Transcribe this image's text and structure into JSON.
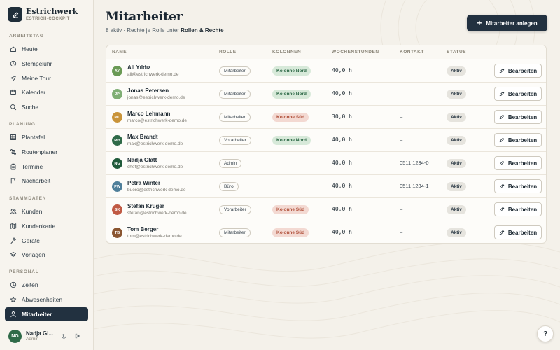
{
  "brand": {
    "name": "Estrichwerk",
    "subtitle": "ESTRICH-COCKPIT"
  },
  "sidebar": {
    "sections": [
      {
        "label": "ARBEITSTAG",
        "items": [
          {
            "label": "Heute",
            "icon": "home-icon"
          },
          {
            "label": "Stempeluhr",
            "icon": "clock-icon"
          },
          {
            "label": "Meine Tour",
            "icon": "send-icon"
          },
          {
            "label": "Kalender",
            "icon": "calendar-icon"
          },
          {
            "label": "Suche",
            "icon": "search-icon"
          }
        ]
      },
      {
        "label": "PLANUNG",
        "items": [
          {
            "label": "Plantafel",
            "icon": "grid-icon"
          },
          {
            "label": "Routenplaner",
            "icon": "route-icon"
          },
          {
            "label": "Termine",
            "icon": "clipboard-icon"
          },
          {
            "label": "Nacharbeit",
            "icon": "flag-icon"
          }
        ]
      },
      {
        "label": "STAMMDATEN",
        "items": [
          {
            "label": "Kunden",
            "icon": "users-icon"
          },
          {
            "label": "Kundenkarte",
            "icon": "map-icon"
          },
          {
            "label": "Geräte",
            "icon": "hammer-icon"
          },
          {
            "label": "Vorlagen",
            "icon": "layers-icon"
          }
        ]
      },
      {
        "label": "PERSONAL",
        "items": [
          {
            "label": "Zeiten",
            "icon": "clock-icon"
          },
          {
            "label": "Abwesenheiten",
            "icon": "star-icon"
          },
          {
            "label": "Mitarbeiter",
            "icon": "user-icon",
            "active": true
          }
        ]
      }
    ]
  },
  "user": {
    "initials": "NG",
    "name": "Nadja Gl...",
    "role": "Admin"
  },
  "page": {
    "title": "Mitarbeiter",
    "subtitle_prefix": "8 aktiv · Rechte je Rolle unter ",
    "subtitle_link": "Rollen & Rechte",
    "add_button": "Mitarbeiter anlegen"
  },
  "table": {
    "headers": {
      "name": "NAME",
      "role": "ROLLE",
      "columns": "KOLONNEN",
      "hours": "WOCHENSTUNDEN",
      "contact": "KONTAKT",
      "status": "STATUS"
    },
    "edit_label": "Bearbeiten",
    "rows": [
      {
        "initials": "AY",
        "avatar_color": "#6a9a55",
        "name": "Ali Yıldız",
        "email": "ali@estrichwerk-demo.de",
        "role": "Mitarbeiter",
        "column": "Kolonne Nord",
        "column_type": "nord",
        "hours": "40,0 h",
        "contact": "–",
        "status": "Aktiv"
      },
      {
        "initials": "JP",
        "avatar_color": "#7fae74",
        "name": "Jonas Petersen",
        "email": "jonas@estrichwerk-demo.de",
        "role": "Mitarbeiter",
        "column": "Kolonne Nord",
        "column_type": "nord",
        "hours": "40,0 h",
        "contact": "–",
        "status": "Aktiv"
      },
      {
        "initials": "ML",
        "avatar_color": "#c9943a",
        "name": "Marco Lehmann",
        "email": "marco@estrichwerk-demo.de",
        "role": "Mitarbeiter",
        "column": "Kolonne Süd",
        "column_type": "sued",
        "hours": "30,0 h",
        "contact": "–",
        "status": "Aktiv"
      },
      {
        "initials": "MB",
        "avatar_color": "#2f6a48",
        "name": "Max Brandt",
        "email": "max@estrichwerk-demo.de",
        "role": "Vorarbeiter",
        "column": "Kolonne Nord",
        "column_type": "nord",
        "hours": "40,0 h",
        "contact": "–",
        "status": "Aktiv"
      },
      {
        "initials": "NG",
        "avatar_color": "#1f5a3a",
        "name": "Nadja Glatt",
        "email": "chef@estrichwerk-demo.de",
        "role": "Admin",
        "column": "",
        "column_type": "",
        "hours": "40,0 h",
        "contact": "0511 1234-0",
        "status": "Aktiv"
      },
      {
        "initials": "PW",
        "avatar_color": "#4f7f9a",
        "name": "Petra Winter",
        "email": "buero@estrichwerk-demo.de",
        "role": "Büro",
        "column": "",
        "column_type": "",
        "hours": "40,0 h",
        "contact": "0511 1234-1",
        "status": "Aktiv"
      },
      {
        "initials": "SK",
        "avatar_color": "#c05a44",
        "name": "Stefan Krüger",
        "email": "stefan@estrichwerk-demo.de",
        "role": "Vorarbeiter",
        "column": "Kolonne Süd",
        "column_type": "sued",
        "hours": "40,0 h",
        "contact": "–",
        "status": "Aktiv"
      },
      {
        "initials": "TB",
        "avatar_color": "#8a5530",
        "name": "Tom Berger",
        "email": "tom@estrichwerk-demo.de",
        "role": "Mitarbeiter",
        "column": "Kolonne Süd",
        "column_type": "sued",
        "hours": "40,0 h",
        "contact": "–",
        "status": "Aktiv"
      }
    ]
  },
  "help": {
    "label": "?"
  }
}
